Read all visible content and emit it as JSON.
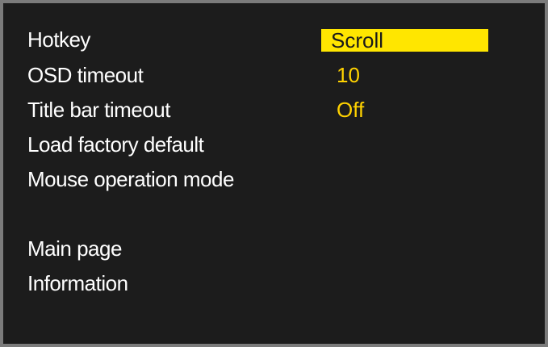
{
  "osd_menu": {
    "items": [
      {
        "label": "Hotkey",
        "value": "Scroll",
        "selected": true
      },
      {
        "label": "OSD timeout",
        "value": "10"
      },
      {
        "label": "Title bar timeout",
        "value": "Off"
      },
      {
        "label": "Load factory default"
      },
      {
        "label": "Mouse operation mode"
      }
    ],
    "nav": [
      {
        "label": "Main page"
      },
      {
        "label": "Information"
      }
    ]
  },
  "colors": {
    "background": "#1c1c1c",
    "border": "#7b7b7b",
    "text": "#ffffff",
    "value_text": "#ffd200",
    "highlight": "#ffe600"
  }
}
